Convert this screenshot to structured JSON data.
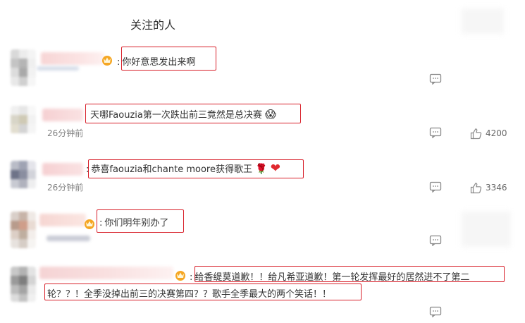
{
  "section": {
    "title": "关注的人"
  },
  "comments": [
    {
      "text": "你好意思发出来啊",
      "timestamp": "",
      "likes": ""
    },
    {
      "text": "天哪Faouzia第一次跌出前三竟然是总决赛",
      "emoji": "😱",
      "timestamp": "26分钟前",
      "likes": "4200"
    },
    {
      "text": "恭喜faouzia和chante moore获得歌王",
      "emoji_rose": "🌹",
      "emoji_heart": "❤",
      "timestamp": "26分钟前",
      "likes": "3346"
    },
    {
      "text": "你们明年别办了",
      "timestamp": "",
      "likes": ""
    },
    {
      "text_line1": "给香缇莫道歉！！给凡希亚道歉！第一轮发挥最好的居然进不了第二",
      "text_line2": "轮？？！全季没掉出前三的决赛第四？？歌手全季最大的两个笑话！！",
      "timestamp": "",
      "likes": ""
    }
  ],
  "colors": {
    "highlight": "#d8202a",
    "meta_text": "#808080",
    "icon": "#888888",
    "badge_gold": "#f5a623"
  },
  "icons": {
    "reply": "comment-icon",
    "like": "thumbs-up-icon",
    "badge": "crown-badge-icon"
  }
}
